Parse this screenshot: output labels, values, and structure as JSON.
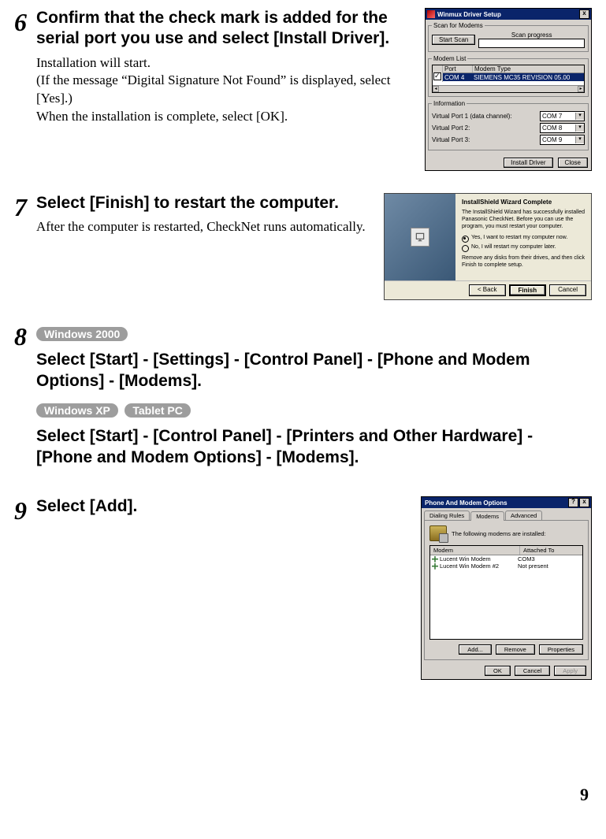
{
  "page_number": "9",
  "steps": {
    "s6": {
      "num": "6",
      "title": "Confirm that the check mark is added for the serial port you use and select [Install Driver].",
      "desc_lines": [
        "Installation will start.",
        "(If the message “Digital Signature Not Found” is displayed, select [Yes].)",
        "When the installation is complete, select [OK]."
      ]
    },
    "s7": {
      "num": "7",
      "title": "Select [Finish] to restart the computer.",
      "desc_lines": [
        "After the computer is restarted, CheckNet runs automatically."
      ]
    },
    "s8": {
      "num": "8",
      "pill_a": "Windows 2000",
      "sub_a": "Select [Start] - [Settings] - [Control Panel] - [Phone and Modem Options] - [Modems].",
      "pill_b1": "Windows XP",
      "pill_b2": "Tablet PC",
      "sub_b": "Select [Start] - [Control Panel] - [Printers and Other Hardware] - [Phone and Modem Options] - [Modems]."
    },
    "s9": {
      "num": "9",
      "title": "Select [Add]."
    }
  },
  "fig1": {
    "title": "Winmux Driver Setup",
    "close": "x",
    "group_scan": "Scan for Modems",
    "label_progress": "Scan progress",
    "btn_scan": "Start Scan",
    "group_list": "Modem List",
    "col_chk": "",
    "col_port": "Port",
    "col_type": "Modem Type",
    "row_port": "COM 4",
    "row_type": "SIEMENS MC35 REVISION 05.00",
    "group_info": "Information",
    "vp1_label": "Virtual Port 1 (data channel):",
    "vp1_value": "COM 7",
    "vp2_label": "Virtual Port 2:",
    "vp2_value": "COM 8",
    "vp3_label": "Virtual Port 3:",
    "vp3_value": "COM 9",
    "btn_install": "Install Driver",
    "btn_close": "Close"
  },
  "fig2": {
    "heading": "InstallShield Wizard Complete",
    "para1": "The InstallShield Wizard has successfully installed Panasonic CheckNet. Before you can use the program, you must restart your computer.",
    "radio1": "Yes, I want to restart my computer now.",
    "radio2": "No, I will restart my computer later.",
    "para2": "Remove any disks from their drives, and then click Finish to complete setup.",
    "btn_back": "< Back",
    "btn_finish": "Finish",
    "btn_cancel": "Cancel"
  },
  "fig3": {
    "title": "Phone And Modem Options",
    "help": "?",
    "close": "x",
    "tabs": {
      "t1": "Dialing Rules",
      "t2": "Modems",
      "t3": "Advanced"
    },
    "intro": "The following modems are installed:",
    "col_modem": "Modem",
    "col_attached": "Attached To",
    "rows": [
      {
        "name": "Lucent Win Modem",
        "port": "COM3"
      },
      {
        "name": "Lucent Win Modem #2",
        "port": "Not present"
      }
    ],
    "btn_add": "Add...",
    "btn_remove": "Remove",
    "btn_props": "Properties",
    "btn_ok": "OK",
    "btn_cancel": "Cancel",
    "btn_apply": "Apply"
  }
}
